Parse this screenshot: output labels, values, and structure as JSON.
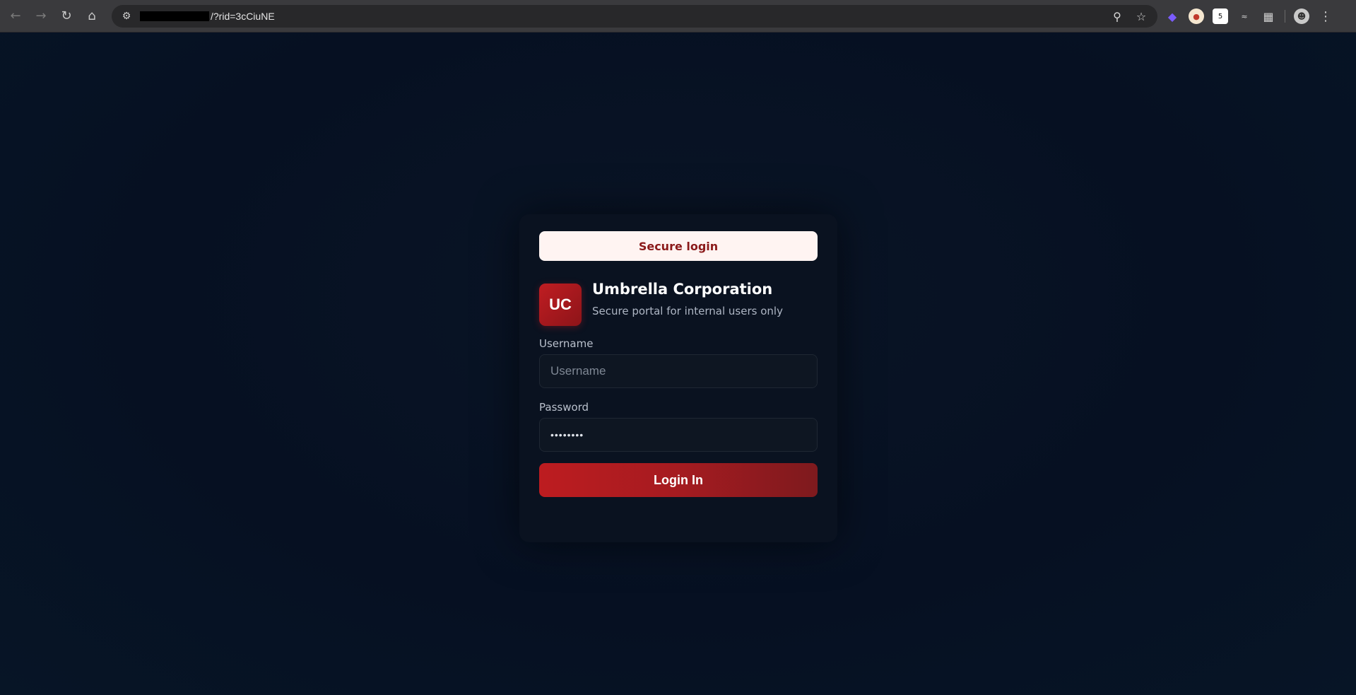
{
  "browser": {
    "url": "/?rid=3cCiuNE",
    "nav": {
      "back_icon": "arrow-left-icon",
      "forward_icon": "arrow-right-icon",
      "reload_icon": "reload-icon",
      "home_icon": "home-icon"
    },
    "extensions_badge": "5"
  },
  "card": {
    "header_label": "Secure login",
    "logo_text": "UC",
    "company_name": "Umbrella Corporation",
    "tagline": "Secure portal for internal users only",
    "username_label": "Username",
    "username_placeholder": "Username",
    "password_label": "Password",
    "password_value": "••••••••",
    "submit_label": "Login In"
  },
  "colors": {
    "page_bg": "#061024",
    "accent": "#bd1c20",
    "pill_bg": "#fff4f2",
    "pill_text": "#8b1a1a"
  }
}
